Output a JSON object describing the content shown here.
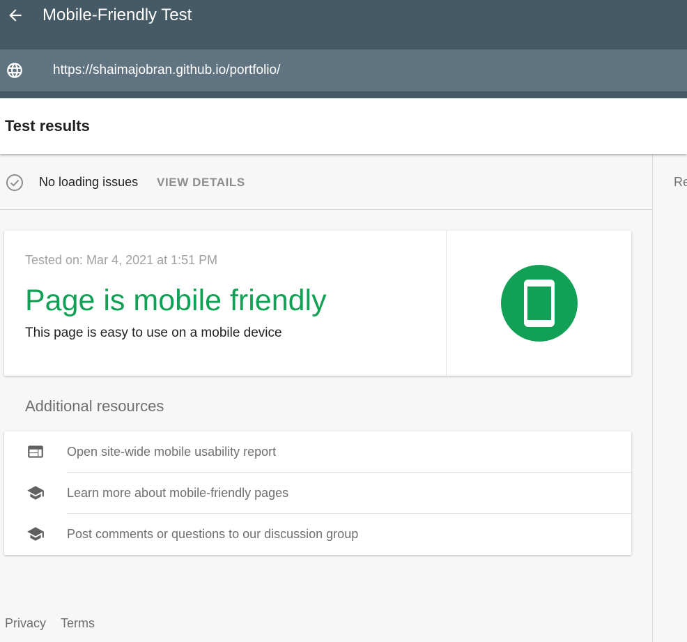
{
  "header": {
    "title": "Mobile-Friendly Test",
    "url": "https://shaimajobran.github.io/portfolio/",
    "back_icon": "arrow-back-icon",
    "url_icon": "globe-icon"
  },
  "results": {
    "heading": "Test results",
    "status_text": "No loading issues",
    "view_details": "VIEW DETAILS",
    "right_panel_peek": "Re"
  },
  "card": {
    "tested_on": "Tested on: Mar 4, 2021 at 1:51 PM",
    "verdict": "Page is mobile friendly",
    "description": "This page is easy to use on a mobile device",
    "badge_icon": "smartphone-icon"
  },
  "resources": {
    "title": "Additional resources",
    "items": [
      {
        "label": "Open site-wide mobile usability report",
        "icon": "web-report-icon"
      },
      {
        "label": "Learn more about mobile-friendly pages",
        "icon": "school-icon"
      },
      {
        "label": "Post comments or questions to our discussion group",
        "icon": "school-icon"
      }
    ]
  },
  "footer": {
    "privacy": "Privacy",
    "terms": "Terms"
  },
  "colors": {
    "appbar": "#465a65",
    "urlbar": "#5f7480",
    "success_green": "#11a055",
    "background": "#f7f7f7"
  }
}
